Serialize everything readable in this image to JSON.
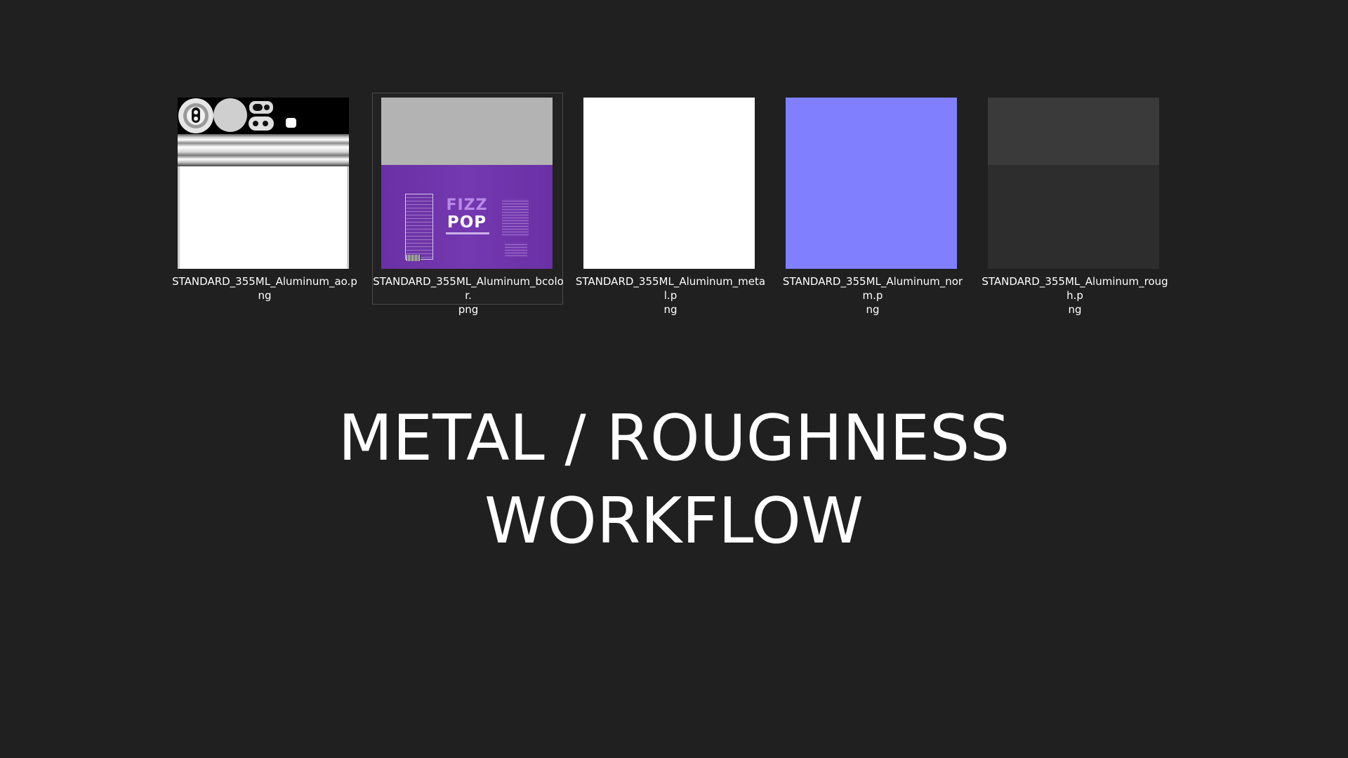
{
  "files": [
    {
      "name_line1": "STANDARD_355ML_Aluminum_ao.png",
      "name_line2": "",
      "thumbnail": "ambient-occlusion-map",
      "selected": false
    },
    {
      "name_line1": "STANDARD_355ML_Aluminum_bcolor.",
      "name_line2": "png",
      "thumbnail": "base-color-map",
      "selected": true,
      "label_text": "FIZZ POP"
    },
    {
      "name_line1": "STANDARD_355ML_Aluminum_metal.p",
      "name_line2": "ng",
      "thumbnail": "metal-map",
      "selected": false
    },
    {
      "name_line1": "STANDARD_355ML_Aluminum_norm.p",
      "name_line2": "ng",
      "thumbnail": "normal-map",
      "selected": false
    },
    {
      "name_line1": "STANDARD_355ML_Aluminum_rough.p",
      "name_line2": "ng",
      "thumbnail": "roughness-map",
      "selected": false
    }
  ],
  "headline": {
    "line1": "METAL / ROUGHNESS",
    "line2": "WORKFLOW"
  },
  "colors": {
    "background": "#202020",
    "text": "#ffffff",
    "normal_map": "#8080ff",
    "base_color_purple": "#6f35a8"
  }
}
